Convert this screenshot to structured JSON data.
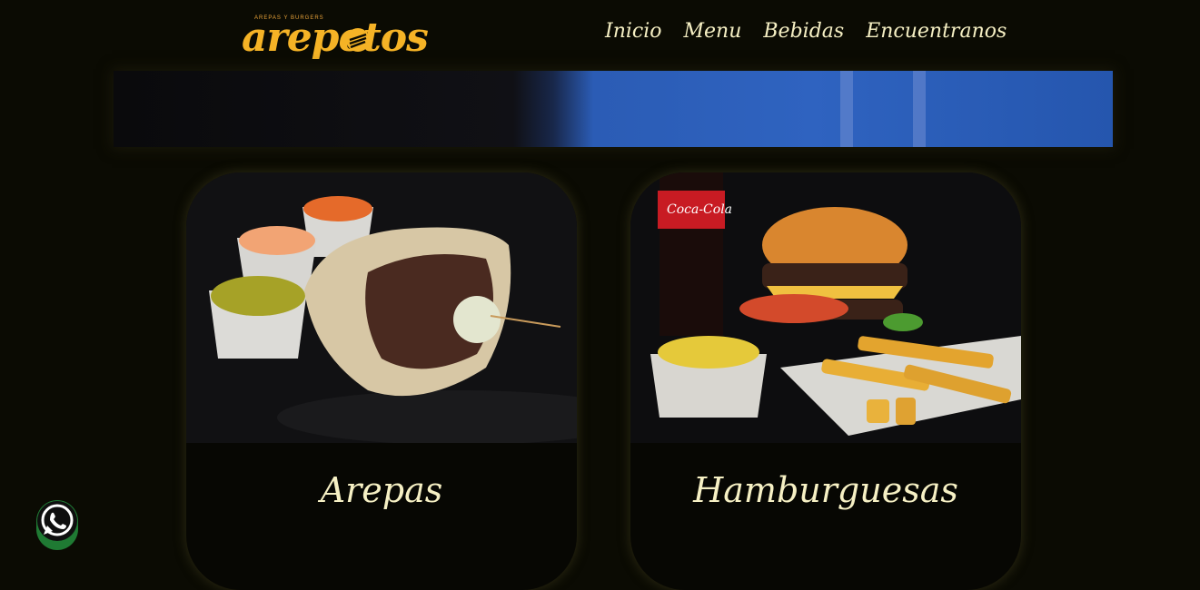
{
  "brand": {
    "name": "arepetos",
    "tagline": "AREPAS Y BURGERS"
  },
  "nav": {
    "items": [
      {
        "label": "Inicio"
      },
      {
        "label": "Menu"
      },
      {
        "label": "Bebidas"
      },
      {
        "label": "Encuentranos"
      }
    ]
  },
  "cards": [
    {
      "title": "Arepas",
      "image": "arepa-with-sauces-photo"
    },
    {
      "title": "Hamburguesas",
      "image": "burger-fries-soda-photo"
    }
  ],
  "floating": {
    "icon": "whatsapp-icon"
  },
  "colors": {
    "background": "#0b0b03",
    "text": "#f6f0c4",
    "brand": "#f5b326",
    "whatsapp": "#1f7a33"
  }
}
